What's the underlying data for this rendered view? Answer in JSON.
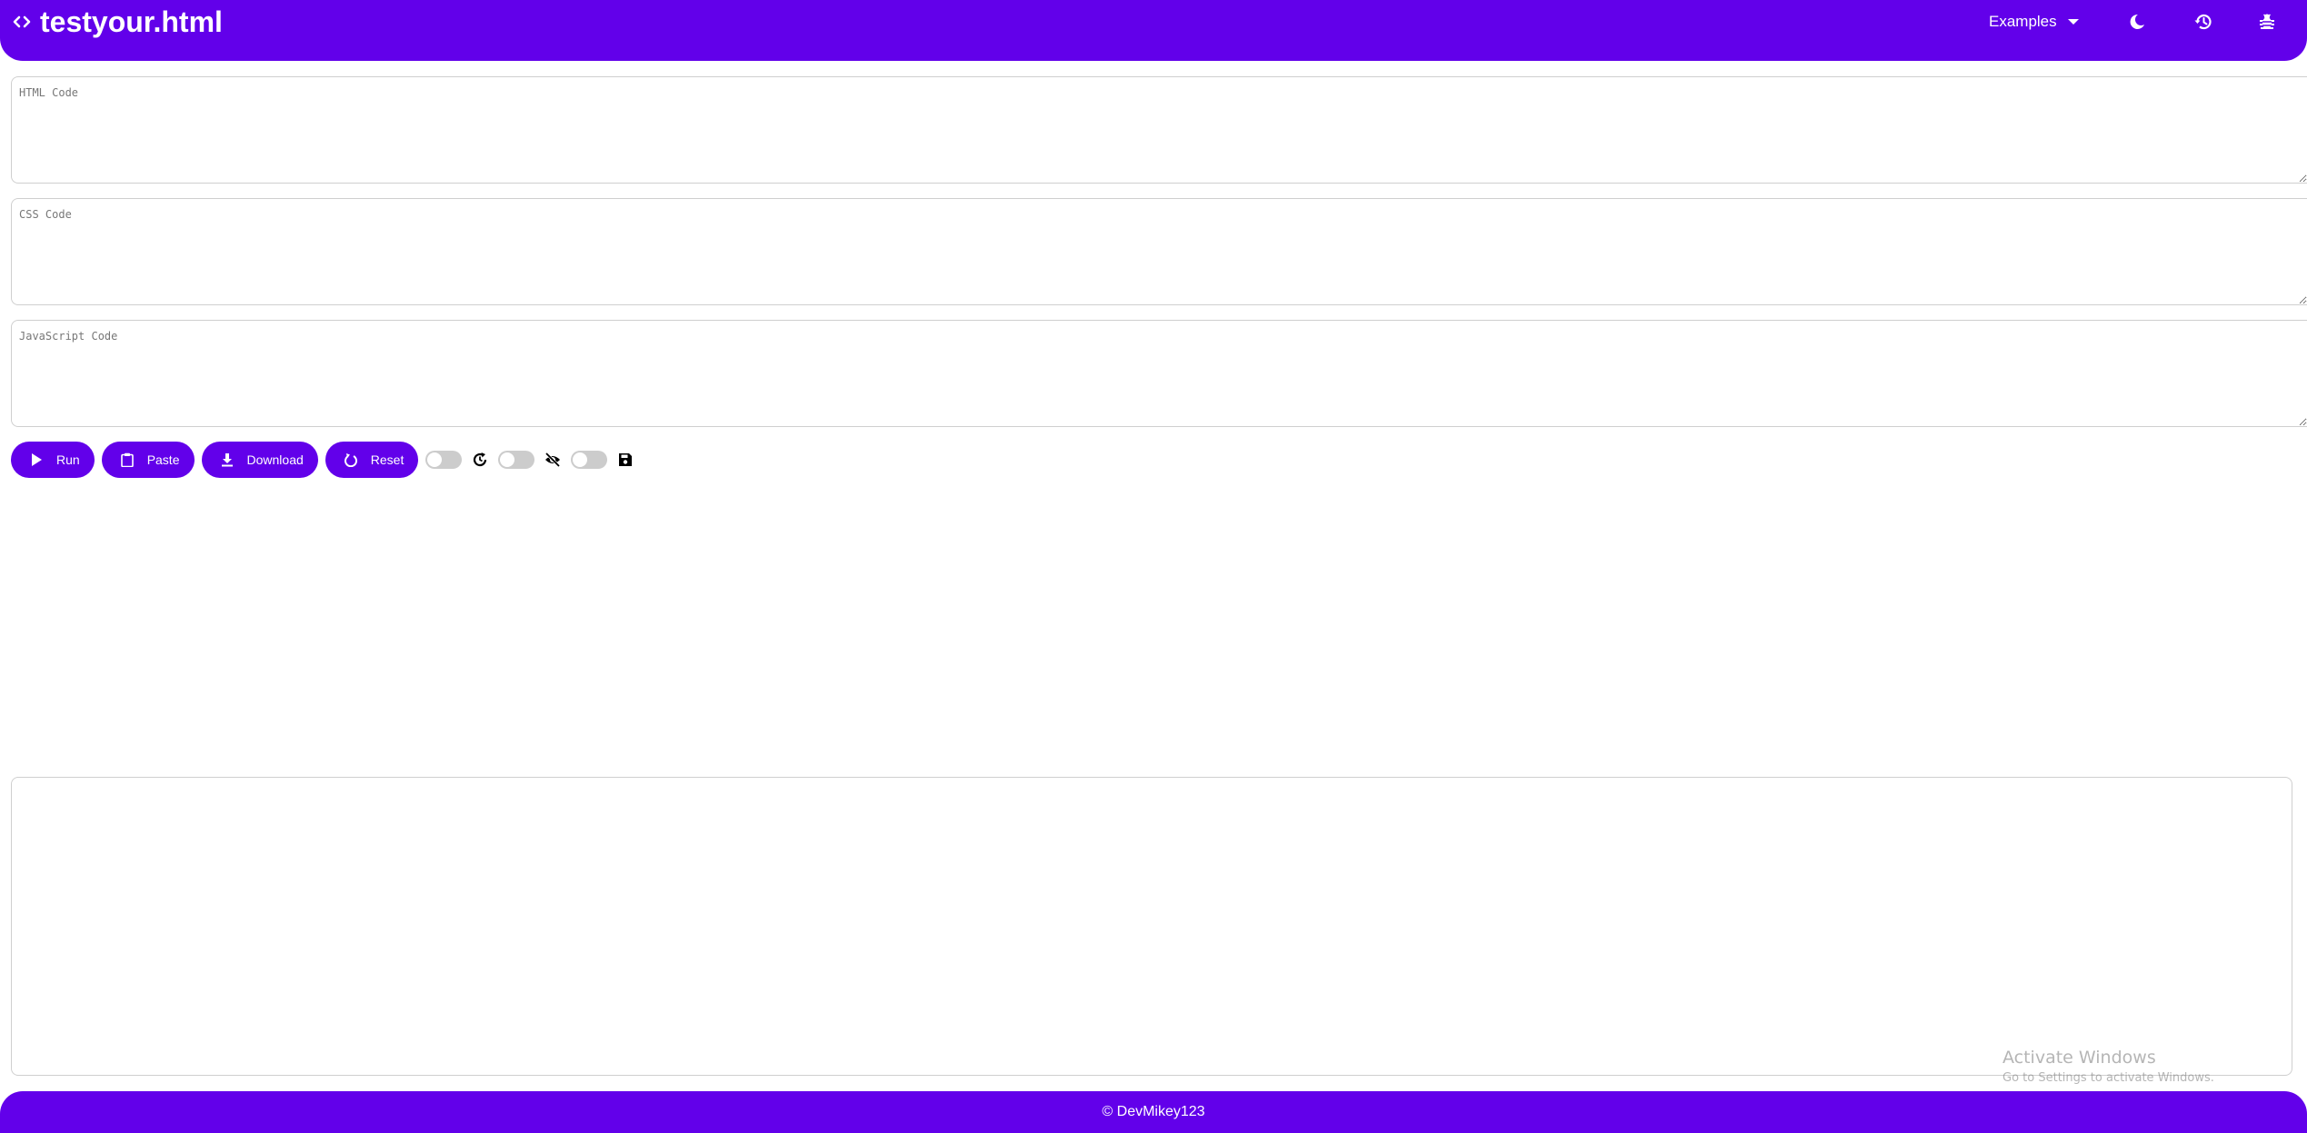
{
  "header": {
    "logo_icon": "code-icon",
    "title": "testyour.html",
    "examples_label": "Examples",
    "icons": [
      "moon-icon",
      "history-icon",
      "bug-icon"
    ]
  },
  "editors": {
    "html_placeholder": "HTML Code",
    "css_placeholder": "CSS Code",
    "js_placeholder": "JavaScript Code",
    "html_value": "",
    "css_value": "",
    "js_value": ""
  },
  "toolbar": {
    "run_label": "Run",
    "paste_label": "Paste",
    "download_label": "Download",
    "reset_label": "Reset",
    "toggles": [
      {
        "icon": "auto-refresh-icon",
        "on": false
      },
      {
        "icon": "eye-slash-icon",
        "on": false
      },
      {
        "icon": "save-icon",
        "on": false
      }
    ]
  },
  "footer": {
    "text": "© DevMikey123"
  },
  "watermark": {
    "title": "Activate Windows",
    "subtitle": "Go to Settings to activate Windows."
  },
  "colors": {
    "primary": "#6200ea",
    "toggle_off": "#cccccc",
    "border": "#cfcfcf"
  }
}
